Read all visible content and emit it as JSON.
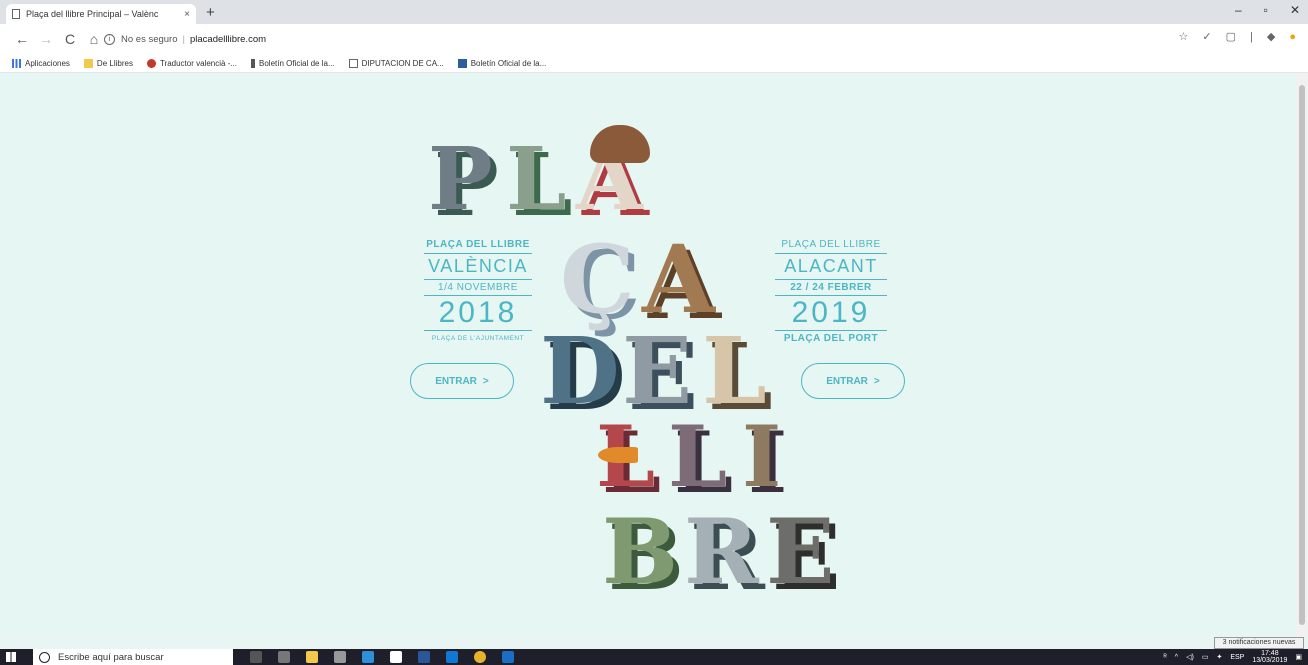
{
  "browser": {
    "tab_title": "Plaça del llibre Principal – Valènc",
    "tab_close": "×",
    "new_tab": "+",
    "window_controls": [
      "–",
      "▫",
      "✕"
    ],
    "security_label": "No es seguro",
    "url": "placadelllibre.com",
    "bookmarks": [
      {
        "label": "Aplicaciones",
        "icon": "apps-grid-icon"
      },
      {
        "label": "De Llibres",
        "icon": "folder-icon"
      },
      {
        "label": "Traductor valencià -...",
        "icon": "sv-logo-icon"
      },
      {
        "label": "Boletín Oficial de la...",
        "icon": "pin-icon"
      },
      {
        "label": "DIPUTACION DE CA...",
        "icon": "file-icon"
      },
      {
        "label": "Boletín Oficial de la...",
        "icon": "bo-logo-icon"
      }
    ]
  },
  "page": {
    "left": {
      "title": "PLAÇA DEL LLIBRE",
      "city": "VALÈNCIA",
      "dates": "1/4 NOVEMBRE",
      "year": "2018",
      "venue": "PLAÇA DE L'AJUNTAMENT",
      "button": "ENTRAR"
    },
    "right": {
      "title": "PLAÇA DEL LLIBRE",
      "city": "ALACANT",
      "dates": "22 / 24 FEBRER",
      "year": "2019",
      "venue": "PLAÇA DEL PORT",
      "button": "ENTRAR"
    },
    "logo_rows": [
      [
        "P",
        "L",
        "A"
      ],
      [
        "Ç",
        "A"
      ],
      [
        "D",
        "E",
        "L"
      ],
      [
        "L",
        "L",
        "I"
      ],
      [
        "B",
        "R",
        "E"
      ]
    ]
  },
  "taskbar": {
    "search_placeholder": "Escribe aquí para buscar",
    "lang": "ESP",
    "time": "17:48",
    "date": "13/03/2019",
    "notification": "3 notificaciones nuevas"
  }
}
